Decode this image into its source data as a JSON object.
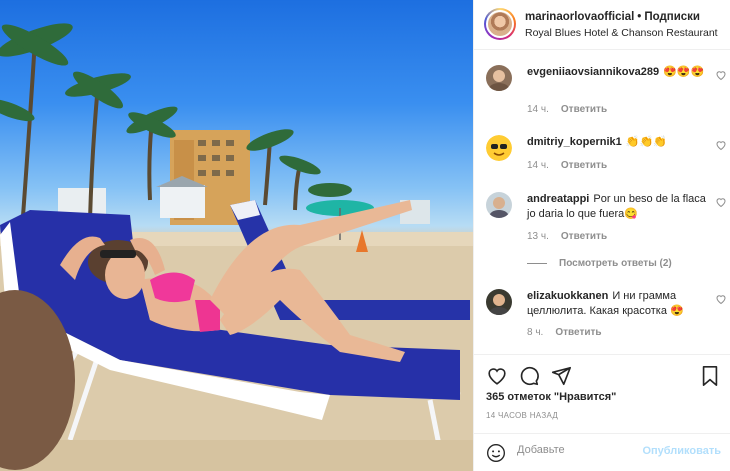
{
  "header": {
    "username": "marinaorlovaofficial",
    "dot": "•",
    "follow_label": "Подписки",
    "location": "Royal Blues Hotel & Chanson Restaurant"
  },
  "comments": [
    {
      "user": "evgeniiaovsiannikova289",
      "text": "😍😍😍",
      "time": "14 ч.",
      "reply": "Ответить"
    },
    {
      "user": "dmitriy_kopernik1",
      "text": "👏👏👏",
      "time": "14 ч.",
      "reply": "Ответить"
    },
    {
      "user": "andreatappi",
      "text": "Por un beso de la flaca jo daria lo que fuera😋",
      "time": "13 ч.",
      "reply": "Ответить"
    },
    {
      "user": "elizakuokkanen",
      "text": "И ни грамма целлюлита. Какая красотка 😍",
      "time": "8 ч.",
      "reply": "Ответить"
    }
  ],
  "view_replies": "Посмотреть ответы (2)",
  "actions": {
    "likes": "365 отметок \"Нравится\"",
    "posted": "14 ЧАСОВ НАЗАД"
  },
  "add_comment": {
    "placeholder": "Добавьте",
    "publish": "Опубликовать"
  },
  "icons": [
    "like-icon",
    "comment-icon",
    "share-icon",
    "bookmark-icon",
    "emoji-icon",
    "heart-outline-icon"
  ],
  "colors": {
    "link": "#b2dffc",
    "muted": "#8e8e8e",
    "text": "#262626"
  }
}
